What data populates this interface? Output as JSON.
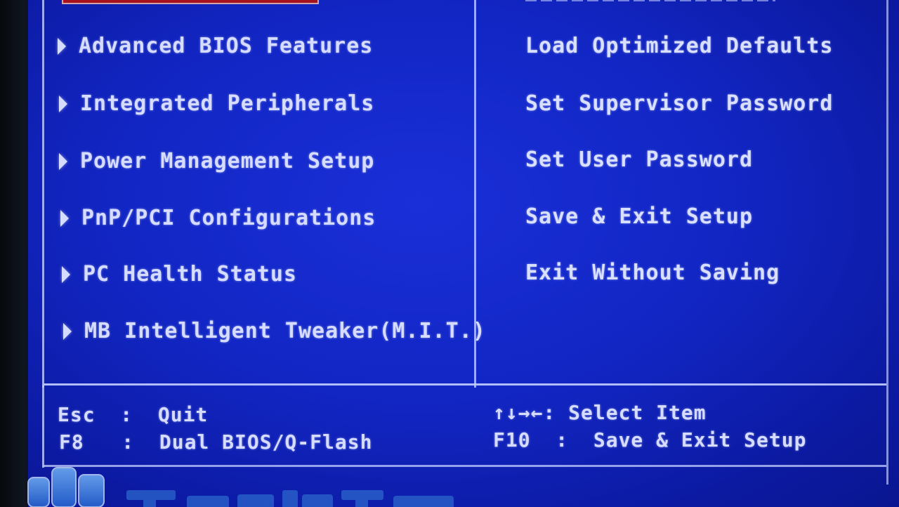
{
  "left_menu": {
    "items": [
      {
        "label": "Advanced BIOS Features"
      },
      {
        "label": "Integrated Peripherals"
      },
      {
        "label": "Power Management Setup"
      },
      {
        "label": "PnP/PCI Configurations"
      },
      {
        "label": "PC Health Status"
      },
      {
        "label": "MB Intelligent Tweaker(M.I.T.)"
      }
    ]
  },
  "right_menu": {
    "items": [
      {
        "label": "Load Optimized Defaults"
      },
      {
        "label": "Set Supervisor Password"
      },
      {
        "label": "Set User Password"
      },
      {
        "label": "Save & Exit Setup"
      },
      {
        "label": "Exit Without Saving"
      }
    ]
  },
  "help": {
    "esc": "Esc  :  Quit",
    "f8": "F8   :  Dual BIOS/Q-Flash",
    "arrows": "↑↓→←: Select Item",
    "f10": "F10  :  Save & Exit Setup"
  },
  "watermark": {
    "text": "TweakTown",
    "icon": "tweaktown-logo-icon"
  },
  "colors": {
    "background": "#1226c4",
    "text": "#d6dcff",
    "selection": "#a6131f"
  }
}
